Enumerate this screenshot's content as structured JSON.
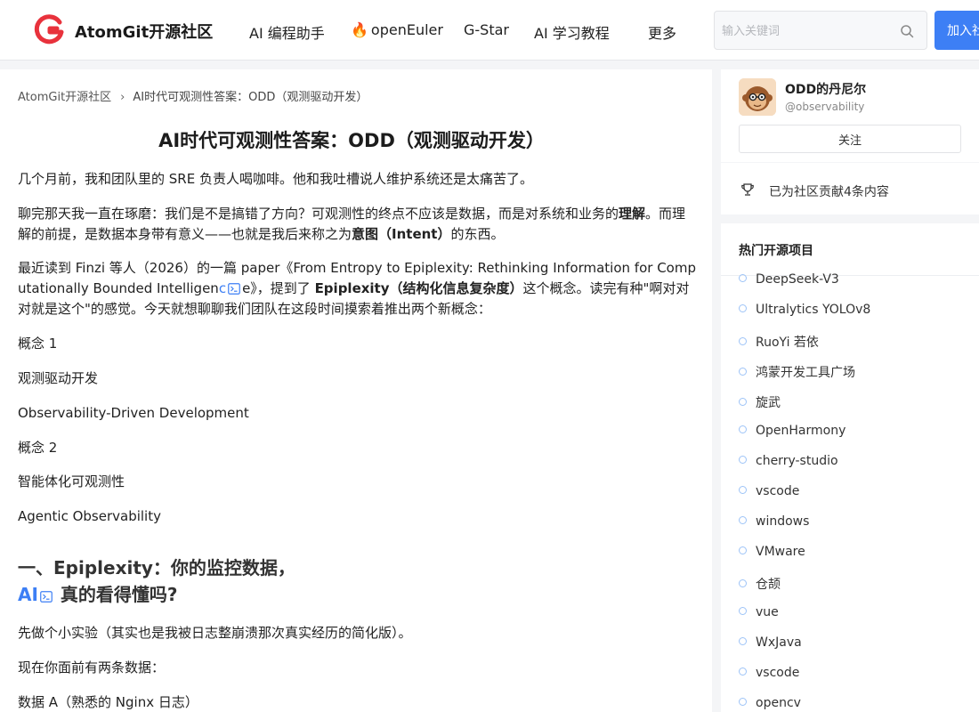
{
  "header": {
    "brand": "AtomGit开源社区",
    "nav": [
      {
        "label": "AI 编程助手"
      },
      {
        "label": "openEuler",
        "icon": "fire-icon"
      },
      {
        "label": "G-Star"
      },
      {
        "label": "AI 学习教程"
      },
      {
        "label": "更多"
      }
    ],
    "search_placeholder": "输入关键词",
    "join_label": "加入社区"
  },
  "breadcrumb": {
    "home": "AtomGit开源社区",
    "current": "AI时代可观测性答案：ODD（观测驱动开发）"
  },
  "article": {
    "title": "AI时代可观测性答案：ODD（观测驱动开发）",
    "p1": "几个月前，我和团队里的 SRE 负责人喝咖啡。他和我吐槽说人维护系统还是太痛苦了。",
    "p2": {
      "a": "聊完那天我一直在琢磨：我们是不是搞错了方向？可观测性的终点不应该是数据，而是对系统和业务的",
      "b": "理解",
      "c": "。而理解的前提，是数据本身带有意义——也就是我后来称之为",
      "d": "意图（Intent）",
      "e": "的东西。"
    },
    "p3": {
      "a": "最近读到 Finzi 等人（2026）的一篇 paper《From Entropy to Epiplexity: Rethinking Information for Computationally Bounded Intelligen",
      "link": "c",
      "b": "e》，提到了 ",
      "bold": "Epiplexity（结构化信息复杂度）",
      "c": "这个概念。读完有种\"啊对对对就是这个\"的感觉。今天就想聊聊我们团队在这段时间摸索着推出两个新概念："
    },
    "concept1_label": "概念 1",
    "concept1_cn": "观测驱动开发",
    "concept1_en": "Observability-Driven Development",
    "concept2_label": "概念 2",
    "concept2_cn": "智能体化可观测性",
    "concept2_en": "Agentic Observability",
    "h2_part1": "一、Epiplexity：你的监控数据，",
    "h2_ai": "AI",
    "h2_part2": "真的看得懂吗?",
    "p4": "先做个小实验（其实也是我被日志整崩溃那次真实经历的简化版）。",
    "p5": "现在你面前有两条数据：",
    "p6": "数据 A（熟悉的 Nginx 日志）"
  },
  "author": {
    "name": "ODD的丹尼尔",
    "handle": "@observability",
    "follow_label": "关注"
  },
  "contribution": {
    "text": "已为社区贡献4条内容"
  },
  "hot": {
    "title": "热门开源项目",
    "items": [
      "DeepSeek-V3",
      "Ultralytics YOLOv8",
      "RuoYi 若依",
      "鸿蒙开发工具广场",
      "旋武",
      "OpenHarmony",
      "cherry-studio",
      "vscode",
      "windows",
      "VMware",
      "仓颉",
      "vue",
      "WxJava",
      "vscode",
      "opencv"
    ]
  }
}
